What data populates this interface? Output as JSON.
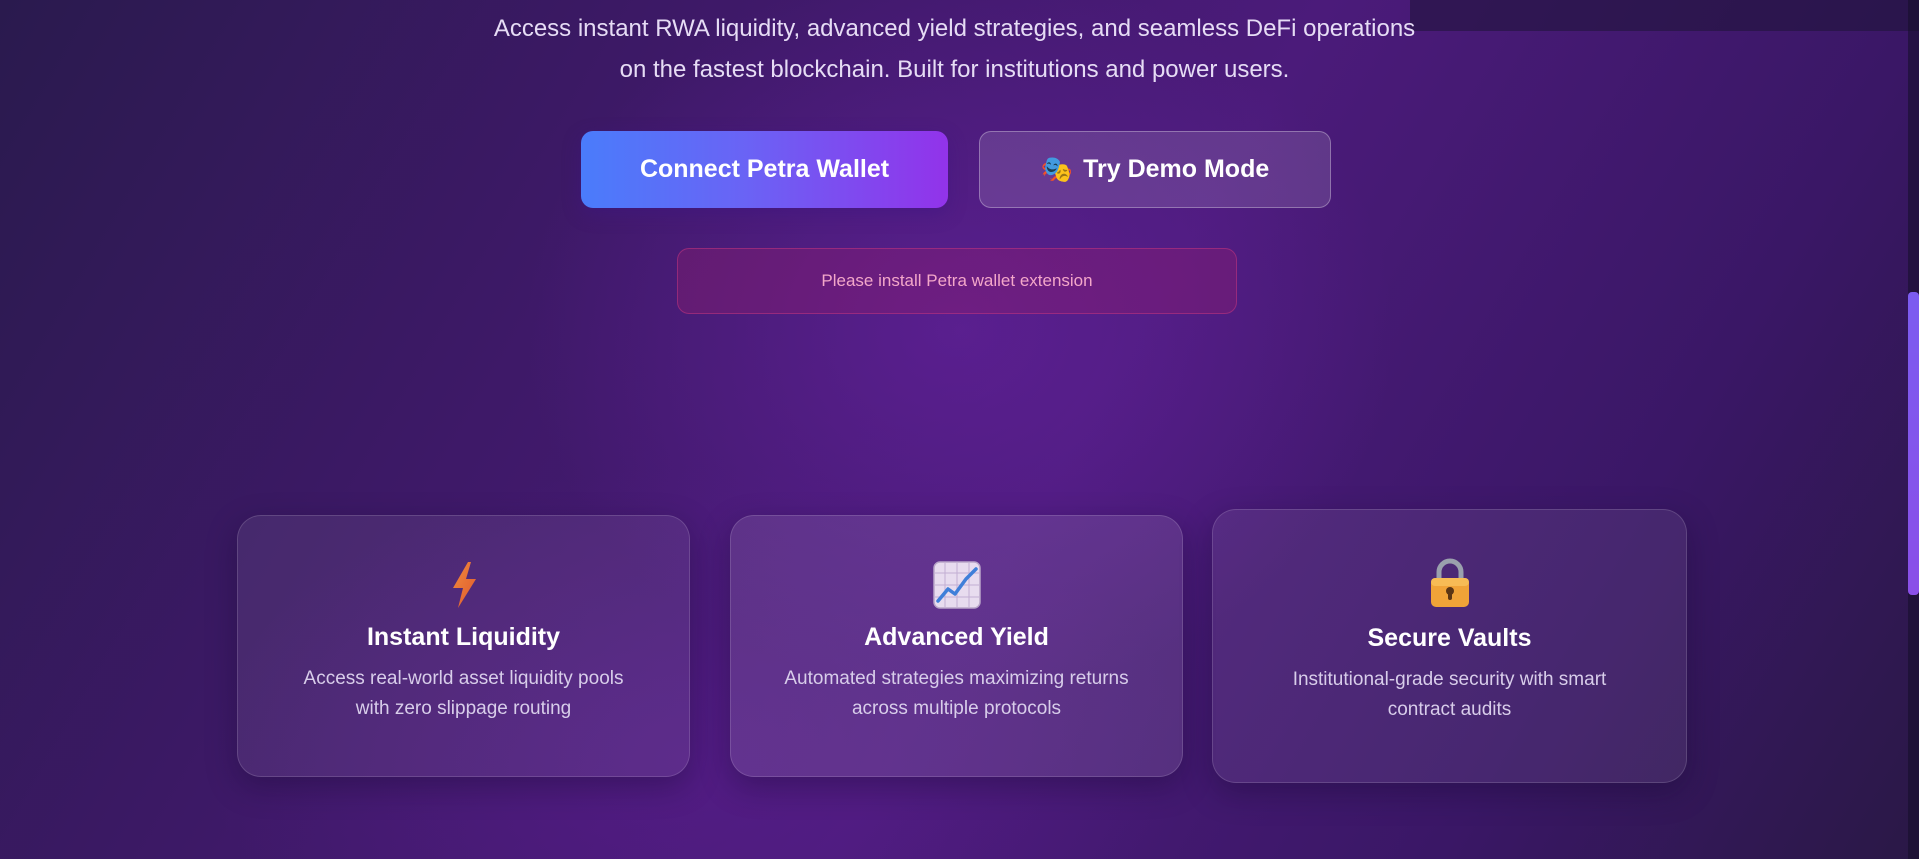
{
  "hero": {
    "subtitle_line1": "Access instant RWA liquidity, advanced yield strategies, and seamless DeFi operations",
    "subtitle_line2": "on the fastest blockchain. Built for institutions and power users."
  },
  "actions": {
    "connect_label": "Connect Petra Wallet",
    "demo_emoji": "🎭",
    "demo_label": "Try Demo Mode"
  },
  "alert": {
    "message": "Please install Petra wallet extension"
  },
  "features": [
    {
      "icon": "lightning-icon",
      "title": "Instant Liquidity",
      "desc_line1": "Access real-world asset liquidity pools",
      "desc_line2": "with zero slippage routing"
    },
    {
      "icon": "chart-increasing-icon",
      "title": "Advanced Yield",
      "desc_line1": "Automated strategies maximizing returns",
      "desc_line2": "across multiple protocols"
    },
    {
      "icon": "lock-icon",
      "title": "Secure Vaults",
      "desc_line1": "Institutional-grade security with smart",
      "desc_line2": "contract audits"
    }
  ],
  "colors": {
    "primary_gradient_start": "#4a7cfb",
    "primary_gradient_end": "#9233ea",
    "alert_text": "#f3a7c9",
    "background": "#3e1968"
  }
}
